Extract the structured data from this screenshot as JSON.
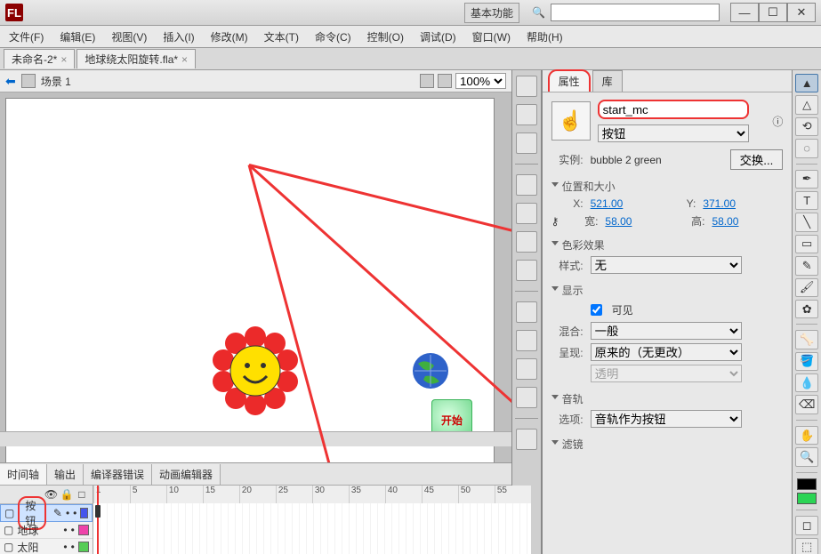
{
  "titlebar": {
    "logo": "FL",
    "basic": "基本功能",
    "search_placeholder": ""
  },
  "menu": [
    "文件(F)",
    "编辑(E)",
    "视图(V)",
    "插入(I)",
    "修改(M)",
    "文本(T)",
    "命令(C)",
    "控制(O)",
    "调试(D)",
    "窗口(W)",
    "帮助(H)"
  ],
  "tabs": [
    {
      "label": "未命名-2*"
    },
    {
      "label": "地球绕太阳旋转.fla*"
    }
  ],
  "scene": {
    "label": "场景 1",
    "zoom": "100%"
  },
  "stage": {
    "start_label": "开始"
  },
  "timeline": {
    "tabs": [
      "时间轴",
      "输出",
      "编译器错误",
      "动画编辑器"
    ],
    "ruler": [
      "1",
      "5",
      "10",
      "15",
      "20",
      "25",
      "30",
      "35",
      "40",
      "45",
      "50",
      "55"
    ],
    "layers": [
      {
        "name": "按钮"
      },
      {
        "name": "地球"
      },
      {
        "name": "太阳"
      }
    ]
  },
  "panel": {
    "tabs": [
      "属性",
      "库"
    ],
    "instance_name": "start_mc",
    "type": "按钮",
    "instance_of_label": "实例:",
    "instance_of_value": "bubble 2 green",
    "swap": "交换...",
    "pos_size_header": "位置和大小",
    "x_label": "X:",
    "x": "521.00",
    "y_label": "Y:",
    "y": "371.00",
    "w_label": "宽:",
    "w": "58.00",
    "h_label": "高:",
    "h": "58.00",
    "color_header": "色彩效果",
    "style_label": "样式:",
    "style_value": "无",
    "display_header": "显示",
    "visible": "可见",
    "blend_label": "混合:",
    "blend_value": "一般",
    "render_label": "呈现:",
    "render_value": "原来的（无更改）",
    "transparent_value": "透明",
    "track_header": "音轨",
    "option_label": "选项:",
    "option_value": "音轨作为按钮",
    "filter_header": "滤镜"
  },
  "colors": {
    "green": "#2bd455",
    "black": "#000000"
  }
}
